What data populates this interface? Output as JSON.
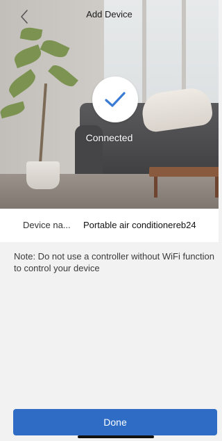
{
  "nav": {
    "title": "Add Device",
    "back_icon": "chevron-left-icon"
  },
  "status": {
    "icon": "checkmark-icon",
    "text": "Connected",
    "check_color": "#3a7bd5"
  },
  "device": {
    "label": "Device na...",
    "name": "Portable air conditionereb24"
  },
  "note": {
    "text": "Note: Do not use a controller without WiFi function to control your device"
  },
  "footer": {
    "done_label": "Done",
    "button_color": "#2e6cc6"
  }
}
